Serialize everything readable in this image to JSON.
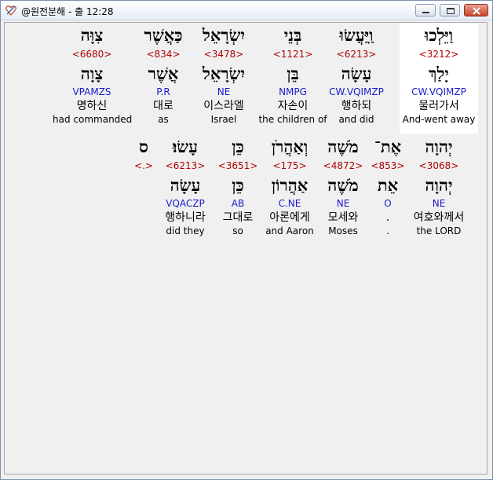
{
  "window": {
    "title": "@원전분해 - 출 12:28"
  },
  "rows": [
    [
      {
        "heb": "וַיֵּלְכוּ",
        "num": "<3212>",
        "root": "יָלַךְ",
        "morph": "CW.VQIMZP",
        "kor": "물러가서",
        "eng": "And-went away",
        "highlight": true
      },
      {
        "heb": "וַֽיַּעֲשׂוּ",
        "num": "<6213>",
        "root": "עָשָׂה",
        "morph": "CW.VQIMZP",
        "kor": "행하되",
        "eng": "and did"
      },
      {
        "heb": "בְּנֵי",
        "num": "<1121>",
        "root": "בֵּן",
        "morph": "NMPG",
        "kor": "자손이",
        "eng": "the children of"
      },
      {
        "heb": "יִשְׂרָאֵל",
        "num": "<3478>",
        "root": "יִשְׂרָאֵל",
        "morph": "NE",
        "kor": "이스라엘",
        "eng": "Israel"
      },
      {
        "heb": "כַּאֲשֶׁר",
        "num": "<834>",
        "root": "אֲשֶׁר",
        "morph": "P.R",
        "kor": "대로",
        "eng": "as"
      },
      {
        "heb": "צִוָּה",
        "num": "<6680>",
        "root": "צָוָה",
        "morph": "VPAMZS",
        "kor": "명하신",
        "eng": "had commanded"
      }
    ],
    [
      {
        "heb": "יְהוָה",
        "num": "<3068>",
        "root": "יְהוָה",
        "morph": "NE",
        "kor": "여호와께서",
        "eng": "the LORD"
      },
      {
        "heb": "אֶת־",
        "num": "<853>",
        "root": "אֵת",
        "morph": "O",
        "kor": ".",
        "eng": "."
      },
      {
        "heb": "מֹשֶׁה",
        "num": "<4872>",
        "root": "מֹשֶׁה",
        "morph": "NE",
        "kor": "모세와",
        "eng": "Moses"
      },
      {
        "heb": "וְאַהֲרֹן",
        "num": "<175>",
        "root": "אַהֲרוֹן",
        "morph": "C.NE",
        "kor": "아론에게",
        "eng": "and Aaron"
      },
      {
        "heb": "כֵּן",
        "num": "<3651>",
        "root": "כֵּן",
        "morph": "AB",
        "kor": "그대로",
        "eng": "so"
      },
      {
        "heb": "עָשׂוּ׃",
        "num": "<6213>",
        "root": "עָשָׂה",
        "morph": "VQACZP",
        "kor": "행하니라",
        "eng": "did they"
      },
      {
        "heb": "ס",
        "num": "<.>"
      }
    ]
  ]
}
